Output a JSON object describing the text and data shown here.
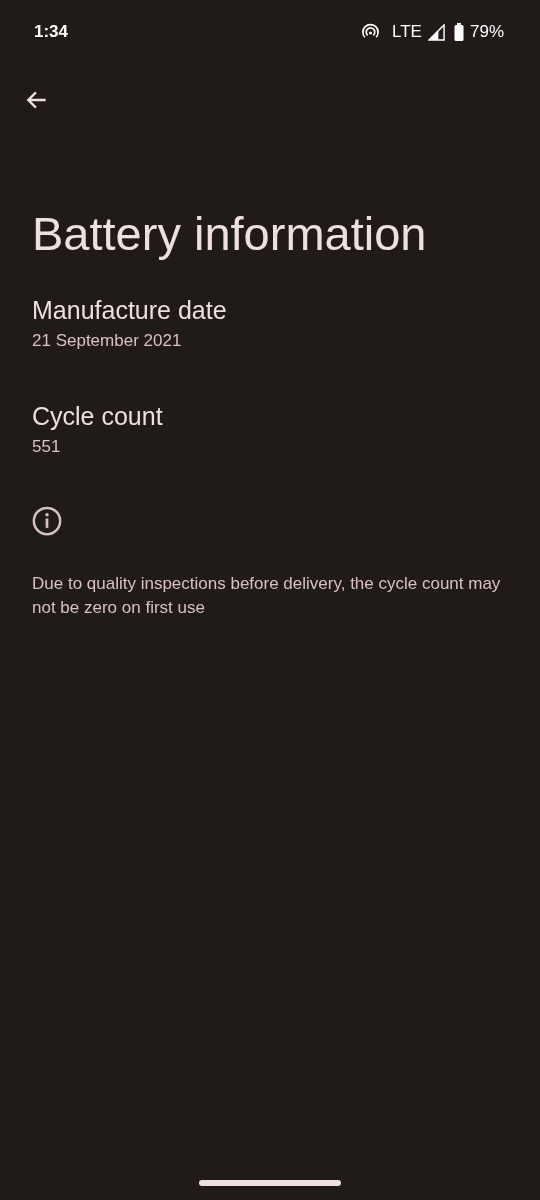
{
  "status_bar": {
    "time": "1:34",
    "network": "LTE",
    "battery": "79%"
  },
  "title": "Battery information",
  "items": [
    {
      "label": "Manufacture date",
      "value": "21 September 2021"
    },
    {
      "label": "Cycle count",
      "value": "551"
    }
  ],
  "footnote": "Due to quality inspections before delivery, the cycle count may not be zero on first use"
}
